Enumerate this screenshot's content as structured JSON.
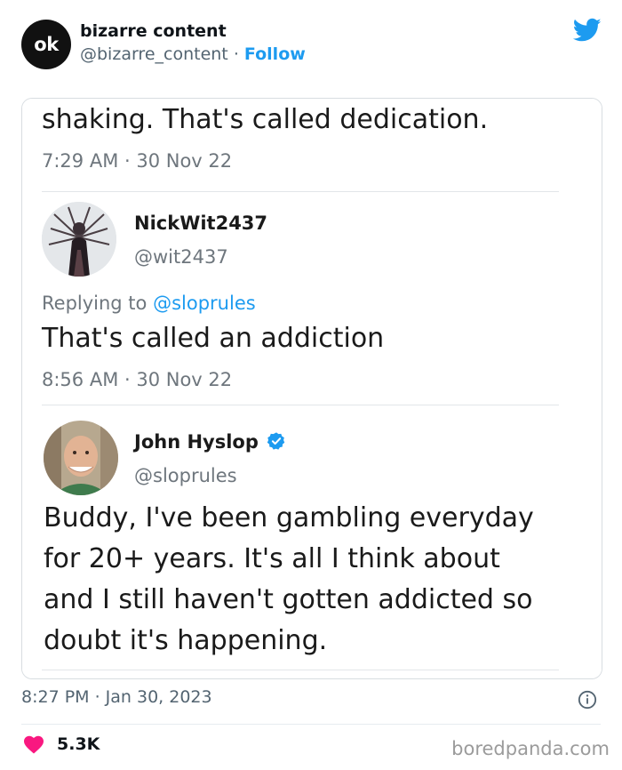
{
  "header": {
    "avatar_text": "ok",
    "name": "bizarre content",
    "handle": "@bizarre_content",
    "separator": "·",
    "follow_label": "Follow",
    "platform_icon": "twitter-bird-icon",
    "accent_color": "#1d9bf0"
  },
  "embedded": {
    "tweet1": {
      "text": "shaking. That's called dedication.",
      "time": "7:29 AM · 30 Nov 22"
    },
    "tweet2": {
      "name": "NickWit2437",
      "handle": "@wit2437",
      "replying_label": "Replying to",
      "replying_handle": "@sloprules",
      "text": "That's called an addiction",
      "time": "8:56 AM · 30 Nov 22"
    },
    "tweet3": {
      "name": "John Hyslop",
      "verified_icon": "verified-badge-icon",
      "handle": "@sloprules",
      "lines": [
        "Buddy, I've been gambling everyday",
        "for 20+ years. It's all I think about",
        "and I still haven't gotten addicted so",
        "doubt it's happening."
      ]
    }
  },
  "footer": {
    "datetime": "8:27 PM · Jan 30, 2023",
    "info_icon": "info-icon",
    "like_icon": "heart-icon",
    "likes": "5.3K",
    "like_color": "#f91880",
    "watermark": "boredpanda.com"
  }
}
